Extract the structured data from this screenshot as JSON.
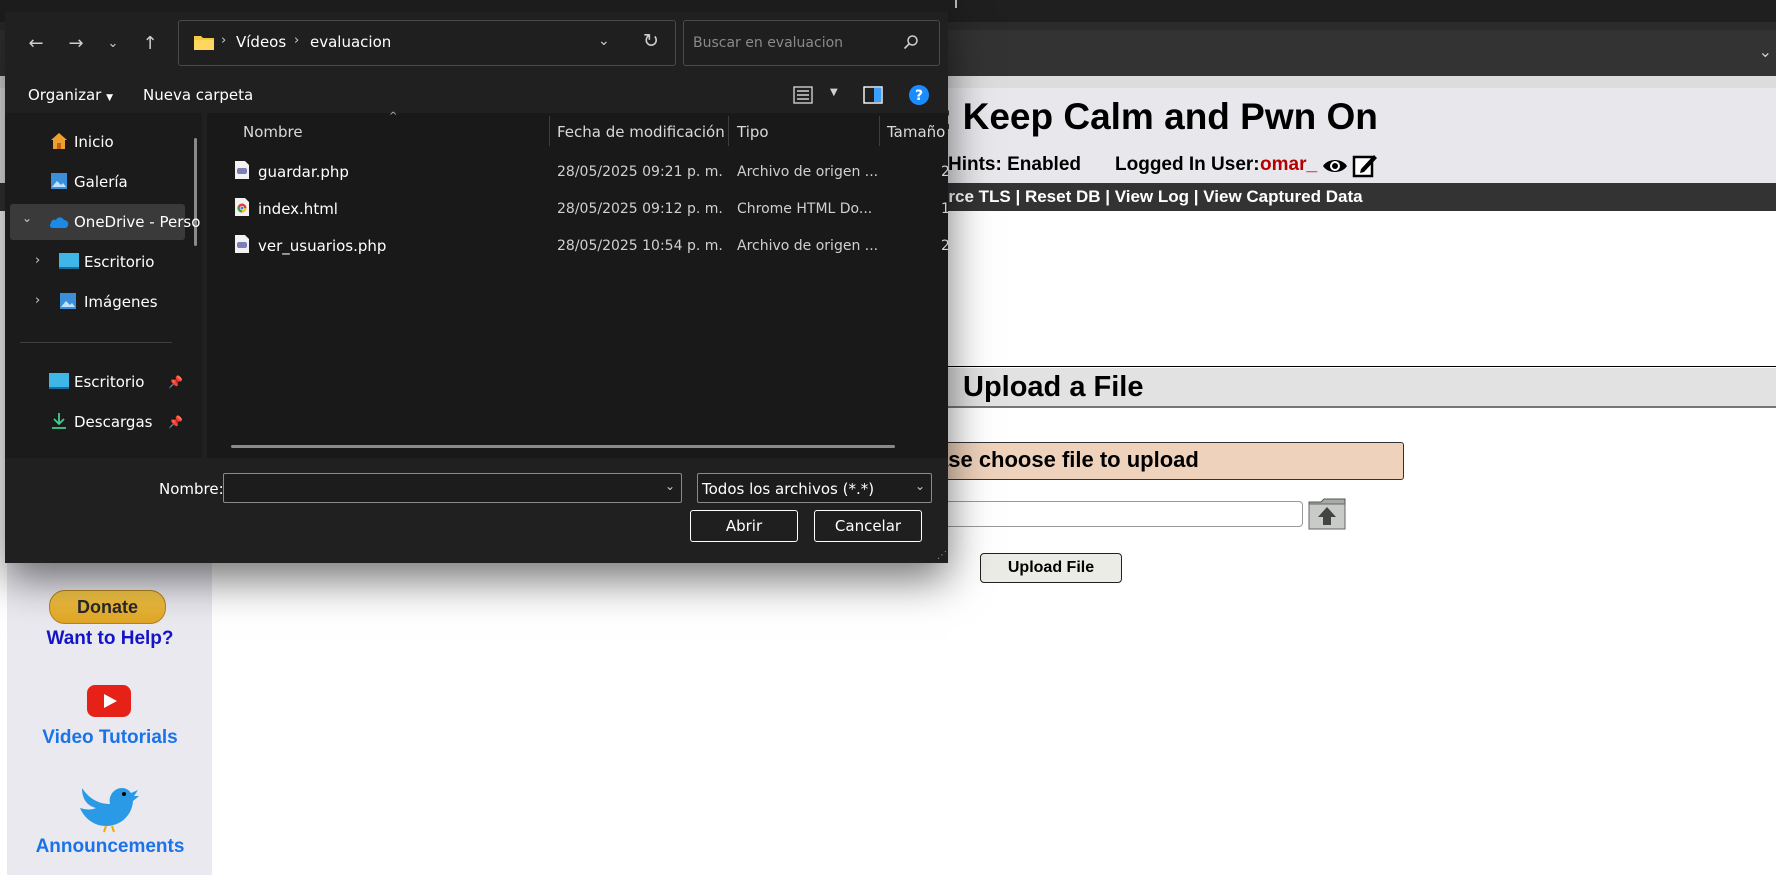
{
  "background_page": {
    "title": ": Keep Calm and Pwn On",
    "hints": "Hints: Enabled",
    "logged_in_label": "Logged In User:",
    "logged_in_user": "omar_",
    "menu": "orce TLS | Reset DB | View Log | View Captured Data",
    "upload_title": "Upload a File",
    "choose_prompt": "ase choose file to upload",
    "upload_button": "Upload File",
    "donate": "Donate",
    "want_help": "Want to Help?",
    "video_tutorials": "Video Tutorials",
    "announcements": "Announcements",
    "colors": {
      "user": "#b30000",
      "menu_bg": "#333333",
      "link": "#1a73e8"
    }
  },
  "dialog": {
    "breadcrumb": [
      "Vídeos",
      "evaluacion"
    ],
    "search_placeholder": "Buscar en evaluacion",
    "toolbar": {
      "organize": "Organizar",
      "new_folder": "Nueva carpeta"
    },
    "nav": {
      "home": "Inicio",
      "gallery": "Galería",
      "onedrive": "OneDrive - Perso",
      "desktop_sub": "Escritorio",
      "images_sub": "Imágenes",
      "desktop_pinned": "Escritorio",
      "downloads_pinned": "Descargas"
    },
    "columns": {
      "name": "Nombre",
      "modified": "Fecha de modificación",
      "type": "Tipo",
      "size": "Tamaño"
    },
    "files": [
      {
        "name": "guardar.php",
        "modified": "28/05/2025 09:21 p. m.",
        "type": "Archivo de origen ...",
        "size": "2",
        "icon": "php-file-icon"
      },
      {
        "name": "index.html",
        "modified": "28/05/2025 09:12 p. m.",
        "type": "Chrome HTML Do...",
        "size": "1",
        "icon": "chrome-html-icon"
      },
      {
        "name": "ver_usuarios.php",
        "modified": "28/05/2025 10:54 p. m.",
        "type": "Archivo de origen ...",
        "size": "2",
        "icon": "php-file-icon"
      }
    ],
    "filename_label": "Nombre:",
    "filename_value": "",
    "filetype": "Todos los archivos (*.*)",
    "open_button": "Abrir",
    "cancel_button": "Cancelar",
    "colors": {
      "bg": "#202020",
      "accent": "#1a8cff"
    }
  }
}
